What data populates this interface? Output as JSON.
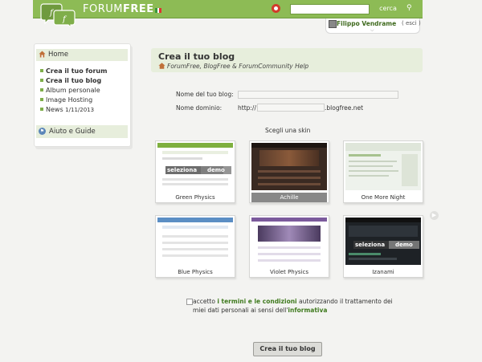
{
  "header": {
    "brand_prefix": "FORUM",
    "brand_suffix": "FREE",
    "search_button": "cerca",
    "search_placeholder": "",
    "accent": "#8dbb55"
  },
  "user": {
    "name": "Filippo Vendrame",
    "logout": "esci"
  },
  "sidebar": {
    "home": "Home",
    "items": [
      {
        "label": "Crea il tuo forum",
        "bold": true
      },
      {
        "label": "Crea il tuo blog",
        "bold": true
      },
      {
        "label": "Album personale",
        "bold": false
      },
      {
        "label": "Image Hosting",
        "bold": false
      },
      {
        "label": "News",
        "date": "1/11/2013",
        "bold": false
      }
    ],
    "help": "Aiuto e Guide"
  },
  "main": {
    "title": "Crea il tuo blog",
    "subtitle": "ForumFree, BlogFree & ForumCommunity Help"
  },
  "form": {
    "blog_name_label": "Nome del tuo blog:",
    "blog_name_value": "",
    "domain_label": "Nome dominio:",
    "domain_prefix": "http://",
    "domain_value": "",
    "domain_suffix": ".blogfree.net",
    "skin_heading": "Scegli una skin"
  },
  "skins": [
    {
      "name": "Green Physics"
    },
    {
      "name": "Achille"
    },
    {
      "name": "One More Night"
    },
    {
      "name": "Blue Physics"
    },
    {
      "name": "Violet Physics"
    },
    {
      "name": "Izanami"
    }
  ],
  "skin_overlay": {
    "select": "seleziona",
    "demo": "demo"
  },
  "terms": {
    "pre": "accetto",
    "link_terms": "i termini e le condizioni",
    "mid": "autorizzando il trattamento dei miei dati personali ai sensi dell'",
    "link_privacy": "informativa"
  },
  "submit_button": "Crea il tuo blog"
}
